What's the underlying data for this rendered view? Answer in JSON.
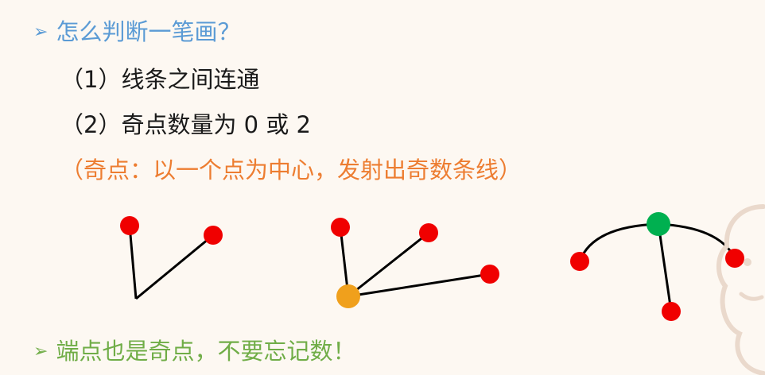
{
  "question": {
    "marker": "➢",
    "text": "怎么判断一笔画？"
  },
  "conditions": [
    {
      "text": "（1）线条之间连通"
    },
    {
      "text": "（2）奇点数量为 0 或 2"
    }
  ],
  "note": {
    "text": "（奇点：以一个点为中心，发射出奇数条线）"
  },
  "tip": {
    "marker": "➢",
    "text": "端点也是奇点，不要忘记数！"
  },
  "colors": {
    "question": "#5b9bd5",
    "note": "#ed7d31",
    "tip": "#70ad47",
    "vertex_red": "#f00000",
    "vertex_orange": "#f0a01c",
    "vertex_green": "#00b050"
  }
}
